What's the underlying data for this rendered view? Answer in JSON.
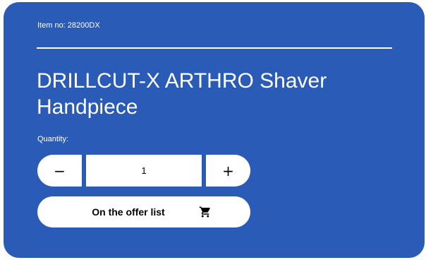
{
  "item": {
    "number_text": "Item no: 28200DX"
  },
  "product": {
    "title": "DRILLCUT-X ARTHRO Shaver Handpiece"
  },
  "quantity": {
    "label": "Quantity:",
    "value": "1",
    "decrement_symbol": "−",
    "increment_symbol": "+"
  },
  "offer_button": {
    "label": "On the offer list",
    "icon": "cart-icon"
  },
  "colors": {
    "card_background": "#2a5bb7",
    "text_on_card": "#ffffff",
    "button_background": "#ffffff",
    "button_text": "#000000"
  }
}
